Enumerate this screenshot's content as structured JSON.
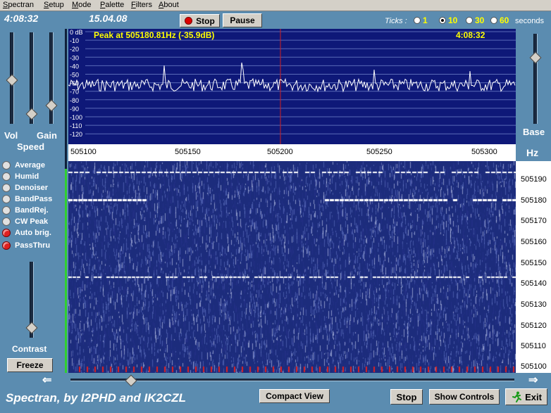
{
  "menu": [
    "Spectran",
    "Setup",
    "Mode",
    "Palette",
    "Filters",
    "About"
  ],
  "clock": "4:08:32",
  "date": "15.04.08",
  "top_buttons": {
    "stop": "Stop",
    "pause": "Pause"
  },
  "ticks": {
    "label": "Ticks :",
    "options": [
      "1",
      "10",
      "30",
      "60"
    ],
    "selected": "10",
    "unit": "seconds"
  },
  "left": {
    "vol": "Vol",
    "gain": "Gain",
    "speed": "Speed",
    "contrast": "Contrast",
    "freeze": "Freeze",
    "options": [
      {
        "label": "Average",
        "on": false
      },
      {
        "label": "Humid",
        "on": false
      },
      {
        "label": "Denoiser",
        "on": false
      },
      {
        "label": "BandPass",
        "on": false
      },
      {
        "label": "BandRej.",
        "on": false
      },
      {
        "label": "CW Peak",
        "on": false
      },
      {
        "label": "Auto brig.",
        "on": true
      },
      {
        "label": "PassThru",
        "on": true
      }
    ]
  },
  "spectrum": {
    "peak_text": "Peak at 505180.81Hz (-35.9dB)",
    "time": "4:08:32",
    "db_labels": [
      "0 dB",
      "-10",
      "-20",
      "-30",
      "-40",
      "-50",
      "-60",
      "-70",
      "-80",
      "-90",
      "-100",
      "-110",
      "-120"
    ],
    "freq_labels": [
      "505100",
      "505150",
      "505200",
      "505250",
      "505300"
    ]
  },
  "right": {
    "base": "Base",
    "hz": "Hz"
  },
  "waterfall": {
    "scale_labels": [
      "505190",
      "505180",
      "505170",
      "505160",
      "505150",
      "505140",
      "505130",
      "505120",
      "505110",
      "505100"
    ]
  },
  "footer": {
    "title": "Spectran, by I2PHD and IK2CZL",
    "compact": "Compact View",
    "stop": "Stop",
    "show_controls": "Show Controls",
    "exit": "Exit"
  },
  "colors": {
    "background": "#5b8cb0",
    "spectrum_bg": "#0e1878",
    "peak_text": "#ffff00",
    "stop_dot": "#d00000"
  }
}
